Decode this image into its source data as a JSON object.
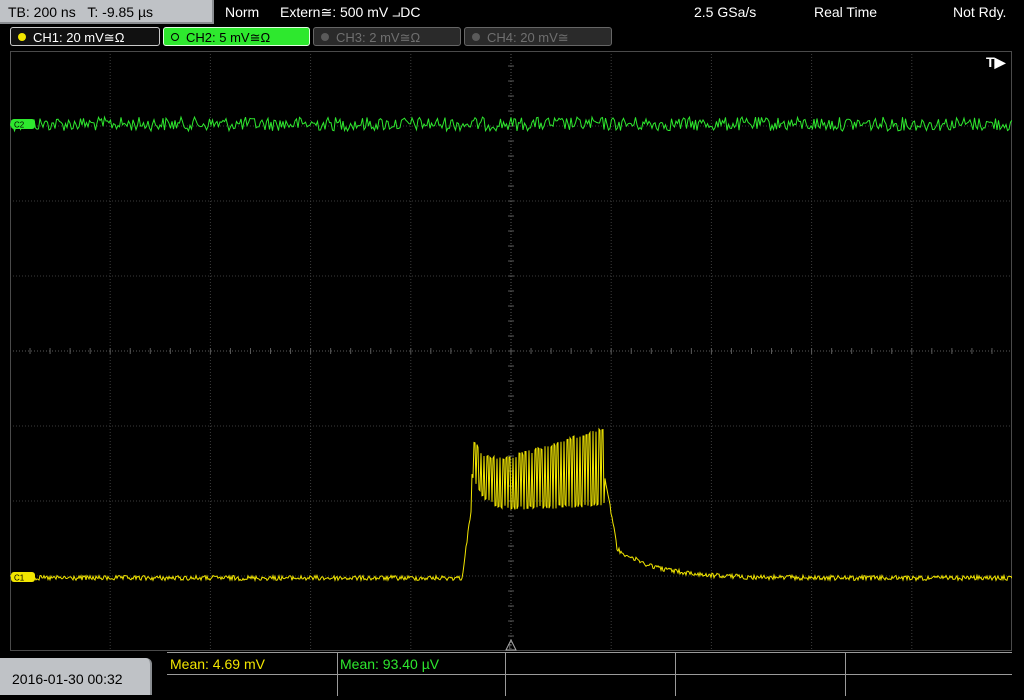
{
  "header": {
    "timebase": "TB: 200 ns",
    "trigger_time": "T: -9.85 µs",
    "mode": "Norm",
    "trigger_source": "Extern≅: 500 mV ⨼DC",
    "sample_rate": "2.5 GSa/s",
    "acq_mode": "Real Time",
    "status": "Not Rdy."
  },
  "channels": [
    {
      "label": "CH1: 20 mV≅Ω",
      "color": "#f2e600",
      "active": true
    },
    {
      "label": "CH2: 5 mV≅Ω",
      "color": "#2ee82e",
      "active": true,
      "selected": true
    },
    {
      "label": "CH3: 2 mV≅Ω",
      "color": "#5a5a5a",
      "active": false
    },
    {
      "label": "CH4: 20 mV≅",
      "color": "#5a5a5a",
      "active": false
    }
  ],
  "markers": {
    "ch1": "C1",
    "ch2": "C2",
    "trigger": "T"
  },
  "footer": {
    "datetime": "2016-01-30 00:32",
    "measurements": [
      {
        "text": "Mean: 4.69 mV",
        "color": "#f2e600"
      },
      {
        "text": "Mean: 93.40 µV",
        "color": "#2ee82e"
      }
    ]
  },
  "colors": {
    "ch1": "#f2e600",
    "ch2": "#2ee82e",
    "grid": "#3c3c3c",
    "header_bg": "#bfc2c6"
  }
}
